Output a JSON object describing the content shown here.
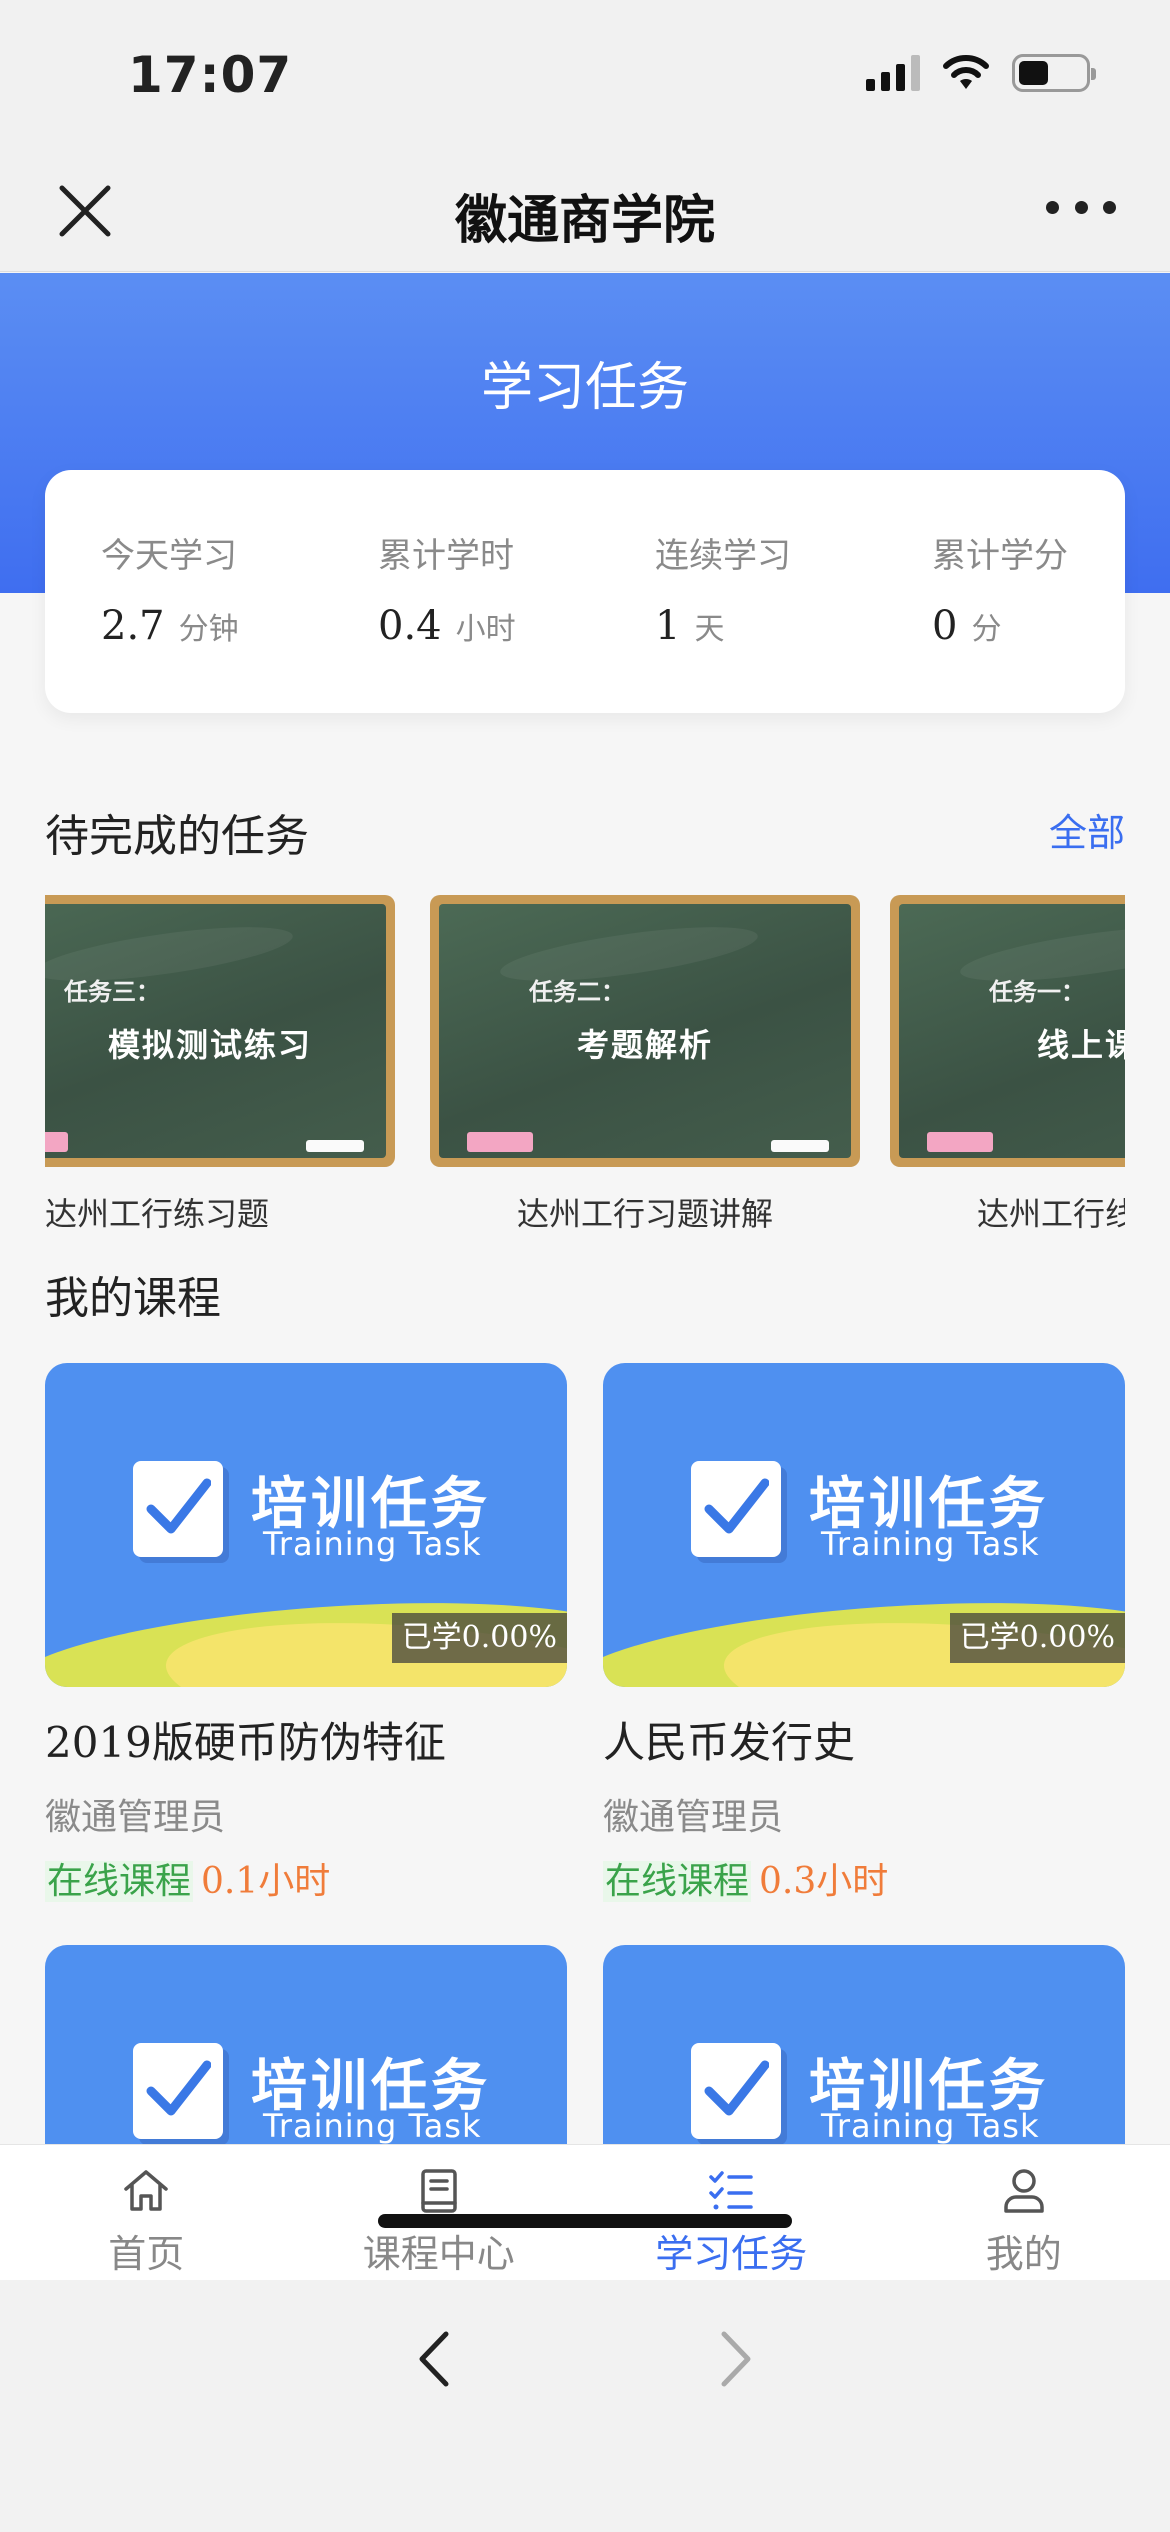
{
  "status_bar": {
    "time": "17:07"
  },
  "nav_bar": {
    "title": "徽通商学院"
  },
  "header": {
    "title": "学习任务"
  },
  "stats": [
    {
      "label": "今天学习",
      "value": "2.7",
      "unit": "分钟"
    },
    {
      "label": "累计学时",
      "value": "0.4",
      "unit": "小时"
    },
    {
      "label": "连续学习",
      "value": "1",
      "unit": "天"
    },
    {
      "label": "累计学分",
      "value": "0",
      "unit": "分"
    }
  ],
  "pending": {
    "title": "待完成的任务",
    "more_label": "全部",
    "tasks": [
      {
        "board_sub": "任务三：",
        "board_main": "模拟测试练习",
        "caption": "达州工行练习题"
      },
      {
        "board_sub": "任务二：",
        "board_main": "考题解析",
        "caption": "达州工行习题讲解"
      },
      {
        "board_sub": "任务一：",
        "board_main": "线上课程",
        "caption": "达州工行线上课程"
      }
    ]
  },
  "courses": {
    "title": "我的课程",
    "thumb_title": "培训任务",
    "thumb_sub": "Training Task",
    "items": [
      {
        "progress": "已学0.00%",
        "name": "2019版硬币防伪特征",
        "author": "徽通管理员",
        "type": "在线课程",
        "duration": "0.1小时"
      },
      {
        "progress": "已学0.00%",
        "name": "人民币发行史",
        "author": "徽通管理员",
        "type": "在线课程",
        "duration": "0.3小时"
      }
    ]
  },
  "tab_bar": {
    "tabs": [
      {
        "label": "首页",
        "icon": "home-icon"
      },
      {
        "label": "课程中心",
        "icon": "book-icon"
      },
      {
        "label": "学习任务",
        "icon": "task-list-icon",
        "active": true
      },
      {
        "label": "我的",
        "icon": "user-icon"
      }
    ]
  },
  "colors": {
    "accent": "#3a6ef0",
    "header_top": "#5b8ef3",
    "course_thumb": "#4f90f0",
    "online_green": "#3aa34a",
    "duration_orange": "#f07c3a"
  }
}
